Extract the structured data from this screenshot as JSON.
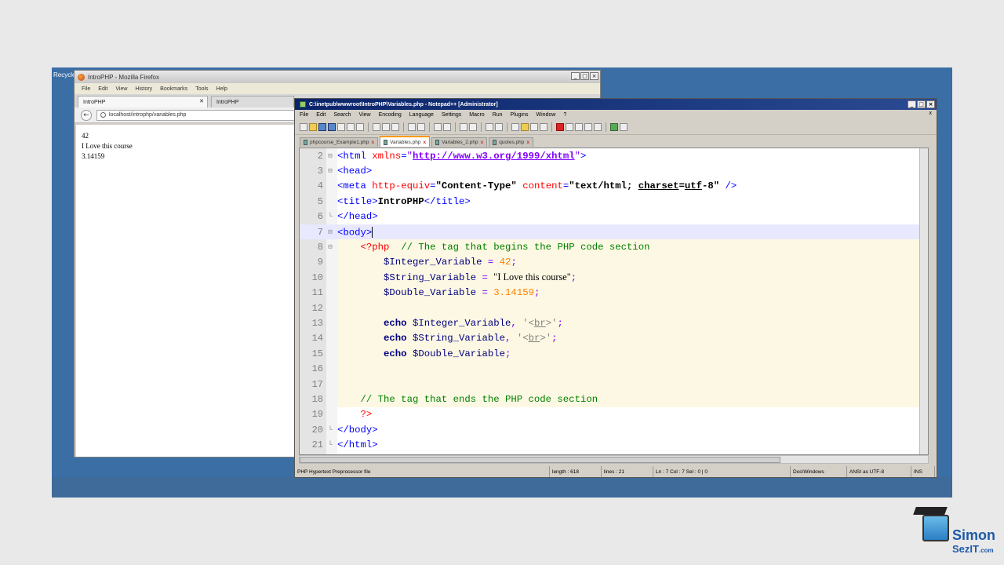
{
  "desktop": {
    "recycle_label": "Recycle Bin"
  },
  "firefox": {
    "title": "IntroPHP - Mozilla Firefox",
    "menu": [
      "File",
      "Edit",
      "View",
      "History",
      "Bookmarks",
      "Tools",
      "Help"
    ],
    "tabs": [
      {
        "label": "IntroPHP"
      },
      {
        "label": "IntroPHP"
      }
    ],
    "url": "localhost/introphp/variables.php",
    "output": [
      "42",
      "I Love this course",
      "3.14159"
    ]
  },
  "npp": {
    "title": "C:\\inetpub\\wwwroot\\IntroPHP\\Variables.php - Notepad++ [Administrator]",
    "menu": [
      "File",
      "Edit",
      "Search",
      "View",
      "Encoding",
      "Language",
      "Settings",
      "Macro",
      "Run",
      "Plugins",
      "Window",
      "?"
    ],
    "tabs": [
      {
        "label": "phpcourse_Example1.php",
        "active": false
      },
      {
        "label": "Variables.php",
        "active": true
      },
      {
        "label": "Variables_2.php",
        "active": false
      },
      {
        "label": "quotes.php",
        "active": false
      }
    ],
    "lines": [
      "2",
      "3",
      "4",
      "5",
      "6",
      "7",
      "8",
      "9",
      "10",
      "11",
      "12",
      "13",
      "14",
      "15",
      "16",
      "17",
      "18",
      "19",
      "20",
      "21"
    ],
    "status": {
      "filetype": "PHP Hypertext Preprocessor file",
      "length": "length : 618",
      "lines": "lines : 21",
      "pos": "Ln : 7   Col : 7   Sel : 0 | 0",
      "eol": "Dos\\Windows",
      "encoding": "ANSI as UTF-8",
      "mode": "INS"
    }
  },
  "logo": {
    "line1": "Simon",
    "line2": "SezIT",
    "suffix": ".com"
  }
}
